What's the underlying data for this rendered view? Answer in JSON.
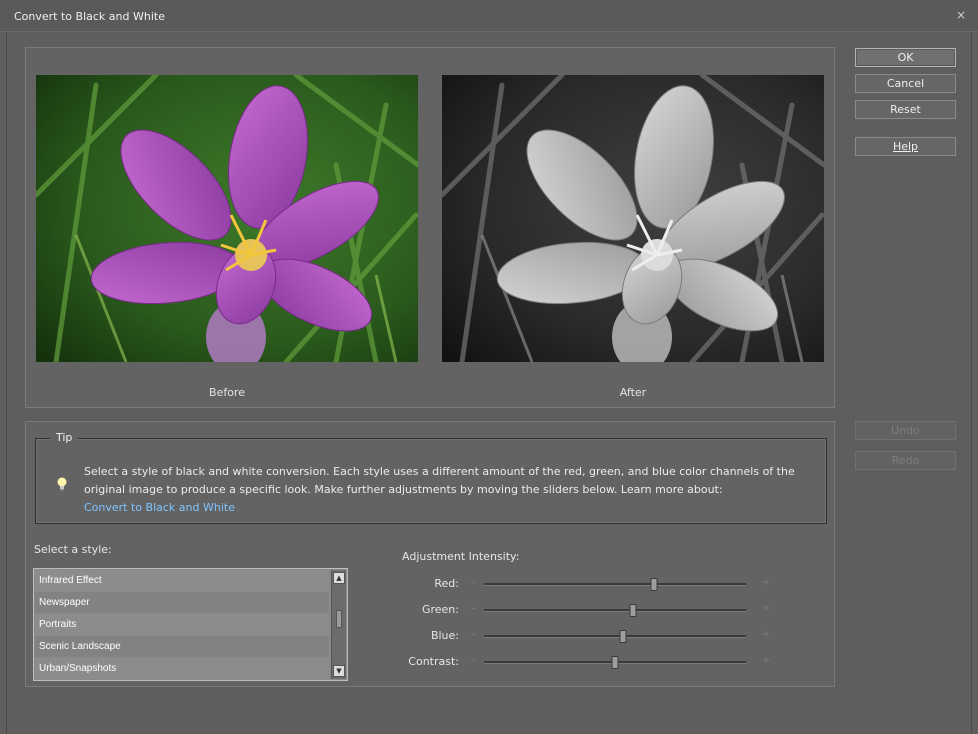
{
  "window": {
    "title": "Convert to Black and White",
    "close_glyph": "×"
  },
  "preview": {
    "before_label": "Before",
    "after_label": "After"
  },
  "buttons": {
    "ok": "OK",
    "cancel": "Cancel",
    "reset": "Reset",
    "help": "Help",
    "undo": "Undo",
    "redo": "Redo"
  },
  "tip": {
    "legend": "Tip",
    "text": "Select a style of black and white conversion. Each style uses a different amount of the red, green, and blue color channels of the original image to produce a specific look. Make further adjustments by moving the sliders below. Learn more about:",
    "link": "Convert to Black and White",
    "icon": "lightbulb-icon"
  },
  "styles": {
    "label": "Select a style:",
    "items": [
      "Infrared Effect",
      "Newspaper",
      "Portraits",
      "Scenic Landscape",
      "Urban/Snapshots"
    ]
  },
  "adjustment": {
    "title": "Adjustment Intensity:",
    "minus": "–",
    "plus": "+",
    "sliders": [
      {
        "label": "Red:",
        "value": 0.65
      },
      {
        "label": "Green:",
        "value": 0.57
      },
      {
        "label": "Blue:",
        "value": 0.53
      },
      {
        "label": "Contrast:",
        "value": 0.5
      }
    ]
  },
  "colors": {
    "link": "#7ec4ff",
    "panel": "#636363",
    "background": "#5e5e5e"
  }
}
